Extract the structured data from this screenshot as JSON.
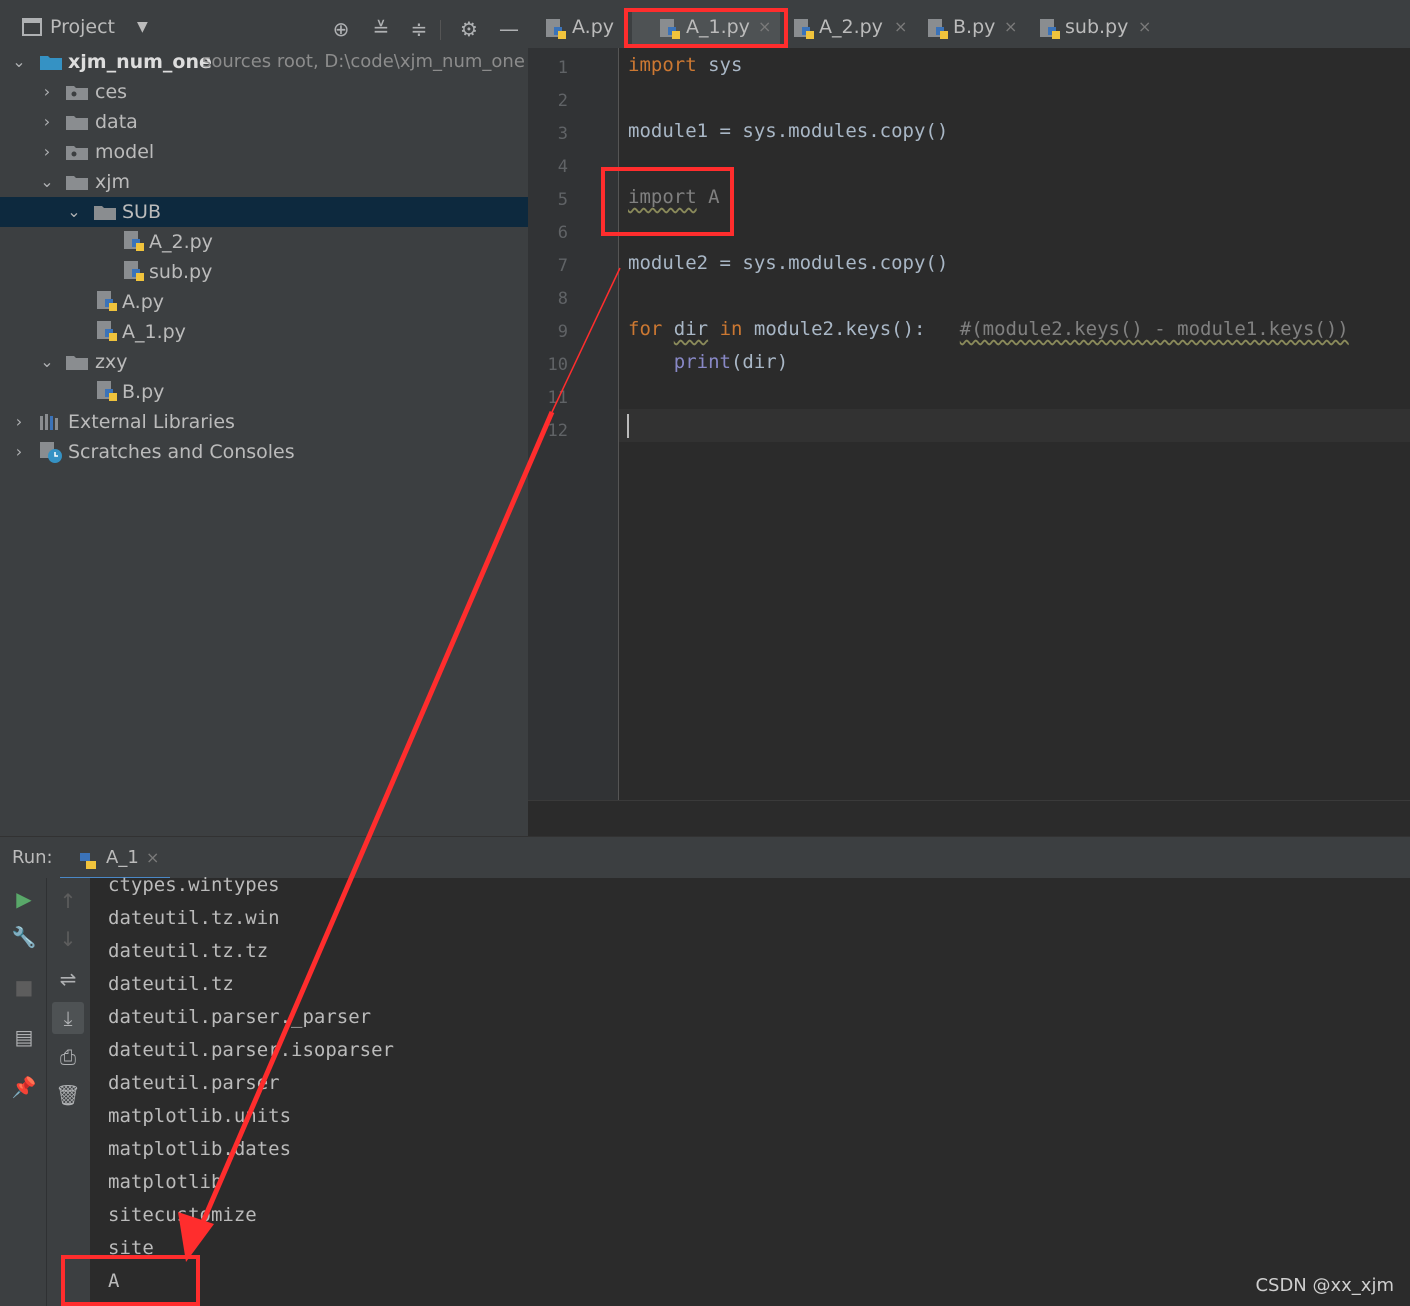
{
  "project": {
    "title": "Project",
    "header_icons": [
      "locate-icon",
      "expand-all-icon",
      "collapse-all-icon",
      "gear-icon",
      "minimize-icon"
    ],
    "root_name": "xjm_num_one",
    "root_hint": "sources root,  D:\\code\\xjm_num_one",
    "items": [
      {
        "label": "ces"
      },
      {
        "label": "data"
      },
      {
        "label": "model"
      },
      {
        "label": "xjm"
      },
      {
        "label": "SUB"
      },
      {
        "label": "A_2.py"
      },
      {
        "label": "sub.py"
      },
      {
        "label": "A.py"
      },
      {
        "label": "A_1.py"
      },
      {
        "label": "zxy"
      },
      {
        "label": "B.py"
      },
      {
        "label": "External Libraries"
      },
      {
        "label": "Scratches and Consoles"
      }
    ]
  },
  "tabs": [
    {
      "label": "A.py"
    },
    {
      "label": "A_1.py",
      "active": true
    },
    {
      "label": "A_2.py"
    },
    {
      "label": "B.py"
    },
    {
      "label": "sub.py"
    }
  ],
  "editor": {
    "line_numbers": [
      "1",
      "2",
      "3",
      "4",
      "5",
      "6",
      "7",
      "8",
      "9",
      "10",
      "11",
      "12"
    ],
    "lines": {
      "l1_kw": "import",
      "l1_rest": " sys",
      "l3": "module1 = sys.modules.copy()",
      "l5_kw": "import",
      "l5_rest": " A",
      "l7": "module2 = sys.modules.copy()",
      "l9_kw": "for",
      "l9_var": "dir",
      "l9_in": "in",
      "l9_rest": " module2.keys():   ",
      "l9_comment": "#(module2.keys() - module1.keys())",
      "l10_fn": "print",
      "l10_rest": "(dir)"
    }
  },
  "run": {
    "label": "Run:",
    "tab_label": "A_1",
    "output": [
      "ctypes.wintypes",
      "dateutil.tz.win",
      "dateutil.tz.tz",
      "dateutil.tz",
      "dateutil.parser._parser",
      "dateutil.parser.isoparser",
      "dateutil.parser",
      "matplotlib.units",
      "matplotlib.dates",
      "matplotlib",
      "sitecustomize",
      "site",
      "A"
    ]
  },
  "watermark": "CSDN @xx_xjm",
  "colors": {
    "keyword": "#cc7832",
    "annotation": "#ff2d2d",
    "selection": "#0d293e"
  }
}
